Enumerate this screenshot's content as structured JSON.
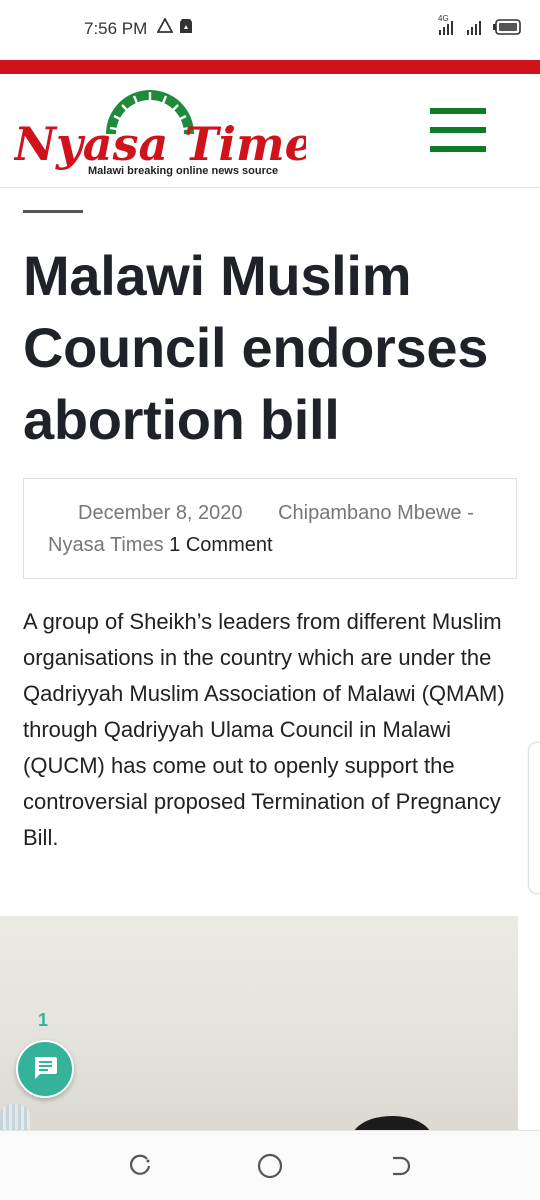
{
  "status_bar": {
    "time": "7:56 PM",
    "network_label": "4G",
    "icons": [
      "warning-triangle-icon",
      "storage-icon",
      "signal-icon",
      "signal-icon",
      "battery-icon"
    ]
  },
  "colors": {
    "brand_red": "#d0121b",
    "menu_green": "#0f7a2a",
    "comment_teal": "#35b39a"
  },
  "header": {
    "logo_text": "Nyasa Times",
    "logo_tagline": "Malawi breaking online news source",
    "menu_icon": "hamburger-menu-icon"
  },
  "article": {
    "title": "Malawi Muslim Council endorses abortion  bill",
    "meta": {
      "date": "December 8, 2020",
      "author": "Chipambano Mbewe - Nyasa Times",
      "comments_link": "1 Comment"
    },
    "body": "A group of Sheikh’s leaders from different Muslim organisations in the country which are under the Qadriyyah Muslim Association of Malawi (QMAM)  through Qadriyyah Ulama Council in Malawi (QUCM)  has come out to openly support the controversial proposed Termination of Pregnancy Bill."
  },
  "comments_widget": {
    "count": "1",
    "icon": "chat-bubble-icon"
  },
  "nav_bar": {
    "icons": [
      "recent-apps-icon",
      "home-icon",
      "back-icon"
    ]
  }
}
